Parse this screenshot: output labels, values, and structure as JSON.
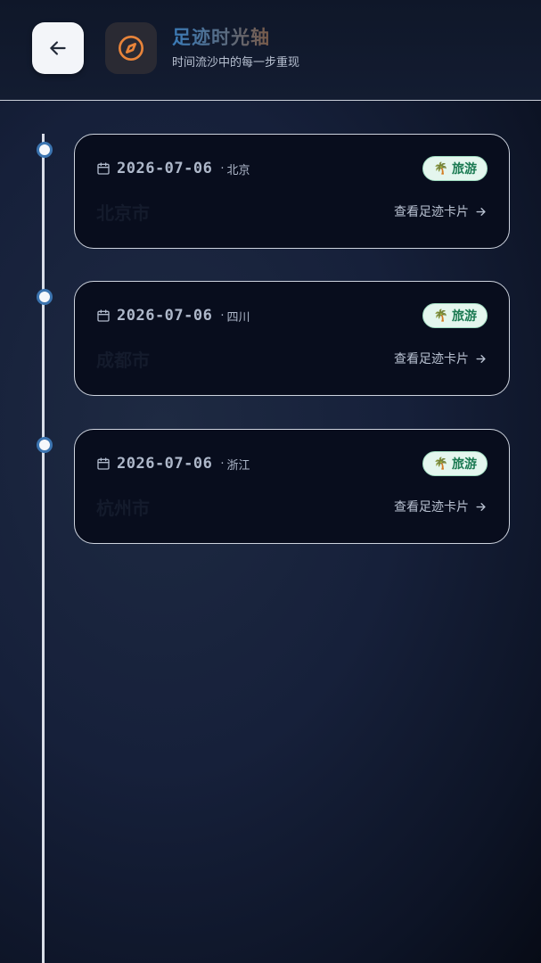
{
  "header": {
    "back_icon": "arrow-left-icon",
    "app_icon": "compass-icon",
    "title": "足迹时光轴",
    "subtitle": "时间流沙中的每一步重现"
  },
  "entries": [
    {
      "date": "2026-07-06",
      "separator": "·",
      "province": "北京",
      "city": "北京市",
      "tag": {
        "icon": "🌴",
        "label": "旅游"
      },
      "link": "查看足迹卡片"
    },
    {
      "date": "2026-07-06",
      "separator": "·",
      "province": "四川",
      "city": "成都市",
      "tag": {
        "icon": "🌴",
        "label": "旅游"
      },
      "link": "查看足迹卡片"
    },
    {
      "date": "2026-07-06",
      "separator": "·",
      "province": "浙江",
      "city": "杭州市",
      "tag": {
        "icon": "🌴",
        "label": "旅游"
      },
      "link": "查看足迹卡片"
    }
  ],
  "colors": {
    "accent_blue": "#3b74b0",
    "tag_green": "#1b7a52",
    "compass_orange": "#e8843a"
  }
}
